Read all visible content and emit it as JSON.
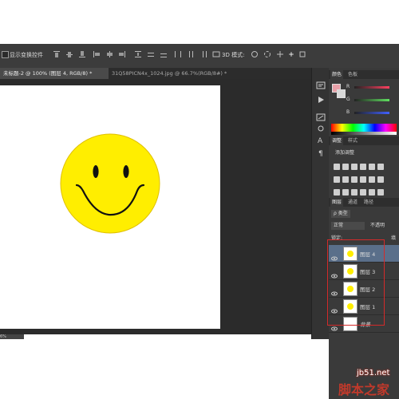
{
  "options_bar": {
    "show_transform_label": "显示变换控件",
    "mode_3d_label": "3D 模式:"
  },
  "doc_tabs": [
    {
      "label": "未标题-2 @ 100% (图层 4, RGB/8) *",
      "active": true
    },
    {
      "label": "31Q58PICN4x_1024.jpg @ 66.7%(RGB/8#) *",
      "active": false
    }
  ],
  "canvas": {
    "smiley_fill": "#ffee00",
    "outline": "#e0c000",
    "feature_color": "#111111"
  },
  "status_bar": {
    "zoom_text": "6%"
  },
  "color_panel": {
    "tabs": [
      "颜色",
      "色板"
    ],
    "foreground": "#e8a0a8",
    "background": "#d8d8d8",
    "sliders": [
      {
        "label": "R",
        "gradient": "#ff4060"
      },
      {
        "label": "G",
        "gradient": "#60e060"
      },
      {
        "label": "B",
        "gradient": "#4060ff"
      }
    ]
  },
  "adjustments_panel": {
    "tabs": [
      "调整",
      "样式"
    ],
    "title": "添加调整"
  },
  "layers_panel": {
    "tabs": [
      "图层",
      "通道",
      "路径"
    ],
    "kind_filter": "ρ 类型",
    "blend_mode": "正常",
    "opacity_label": "不透明",
    "lock_label": "锁定:",
    "fill_label": "填",
    "layers": [
      {
        "name": "图层 4",
        "selected": true,
        "is_background": false
      },
      {
        "name": "图层 3",
        "selected": false,
        "is_background": false
      },
      {
        "name": "图层 2",
        "selected": false,
        "is_background": false
      },
      {
        "name": "图层 1",
        "selected": false,
        "is_background": false
      },
      {
        "name": "背景",
        "selected": false,
        "is_background": true
      }
    ]
  },
  "watermark": {
    "url": "jb51.net",
    "site": "脚本之家"
  },
  "highlight_color": "#d42a2a"
}
